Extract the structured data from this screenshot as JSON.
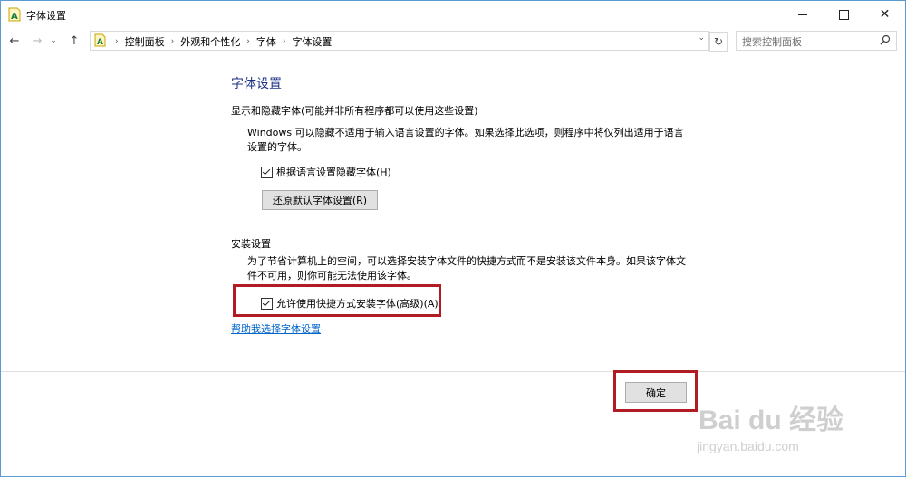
{
  "window": {
    "title": "字体设置"
  },
  "nav": {
    "breadcrumbs": [
      "控制面板",
      "外观和个性化",
      "字体",
      "字体设置"
    ],
    "search_placeholder": "搜索控制面板"
  },
  "main": {
    "title": "字体设置",
    "show_hide": {
      "label": "显示和隐藏字体(可能并非所有程序都可以使用这些设置)",
      "description": "Windows 可以隐藏不适用于输入语言设置的字体。如果选择此选项，则程序中将仅列出适用于语言设置的字体。",
      "checkbox_label": "根据语言设置隐藏字体(H)",
      "checkbox_checked": true,
      "restore_button": "还原默认字体设置(R)"
    },
    "install": {
      "label": "安装设置",
      "description": "为了节省计算机上的空间，可以选择安装字体文件的快捷方式而不是安装该文件本身。如果该字体文件不可用，则你可能无法使用该字体。",
      "checkbox_label": "允许使用快捷方式安装字体(高级)(A)",
      "checkbox_checked": true
    },
    "help_link": "帮助我选择字体设置"
  },
  "footer": {
    "ok_button": "确定"
  },
  "watermark": {
    "brand": "Bai du 经验",
    "url": "jingyan.baidu.com"
  },
  "colors": {
    "accent_title": "#1e3287",
    "link": "#0066cc",
    "highlight": "#b01c22"
  }
}
